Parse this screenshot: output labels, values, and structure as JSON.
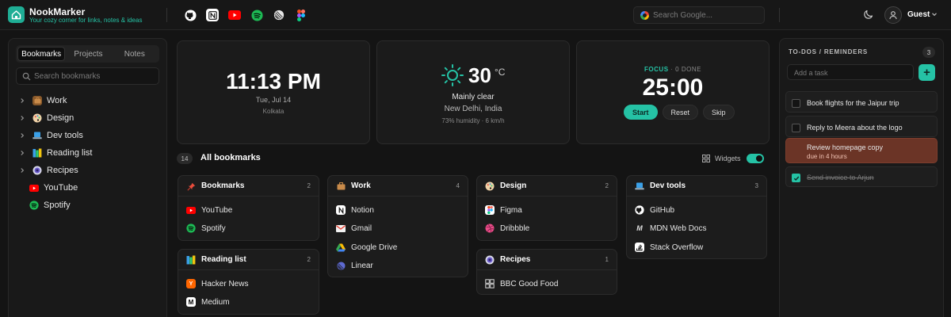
{
  "app": {
    "name": "NookMarker",
    "tagline": "Your cozy corner for links, notes & ideas"
  },
  "header": {
    "quick_links": [
      {
        "icon": "github-icon",
        "color": "#ffffff"
      },
      {
        "icon": "notion-icon",
        "color": "#ffffff"
      },
      {
        "icon": "youtube-icon",
        "color": "#ff0000"
      },
      {
        "icon": "spotify-icon",
        "color": "#1db954"
      },
      {
        "icon": "linear-icon",
        "color": "#e6e6e6"
      },
      {
        "icon": "figma-icon",
        "color": "#f24e1e"
      }
    ],
    "search_placeholder": "Search Google...",
    "user": "Guest"
  },
  "sidebar": {
    "tabs": [
      "Bookmarks",
      "Projects",
      "Notes"
    ],
    "active_tab": "Bookmarks",
    "search_placeholder": "Search bookmarks",
    "items": [
      {
        "label": "Work",
        "icon": "briefcase-icon",
        "expandable": true
      },
      {
        "label": "Design",
        "icon": "palette-icon",
        "expandable": true
      },
      {
        "label": "Dev tools",
        "icon": "laptop-icon",
        "expandable": true
      },
      {
        "label": "Reading list",
        "icon": "books-icon",
        "expandable": true
      },
      {
        "label": "Recipes",
        "icon": "recipes-icon",
        "expandable": true
      },
      {
        "label": "YouTube",
        "icon": "youtube-icon",
        "expandable": false
      },
      {
        "label": "Spotify",
        "icon": "spotify-icon",
        "expandable": false
      }
    ]
  },
  "clock": {
    "time": "11:13 PM",
    "date": "Tue, Jul 14",
    "city": "Kolkata"
  },
  "weather": {
    "temp": "30",
    "unit": "°C",
    "condition": "Mainly clear",
    "location": "New Delhi, India",
    "details": "73% humidity · 6 km/h"
  },
  "focus": {
    "label": "FOCUS",
    "separator": "·",
    "done": "0 DONE",
    "timer": "25:00",
    "start": "Start",
    "reset": "Reset",
    "skip": "Skip"
  },
  "bookmarks": {
    "count": "14",
    "title": "All bookmarks",
    "widgets_label": "Widgets",
    "widgets_on": true,
    "groups": [
      {
        "title": "Bookmarks",
        "count": "2",
        "icon": "pin-icon",
        "items": [
          {
            "label": "YouTube",
            "icon": "youtube-icon"
          },
          {
            "label": "Spotify",
            "icon": "spotify-icon"
          }
        ]
      },
      {
        "title": "Reading list",
        "count": "2",
        "icon": "books-icon",
        "items": [
          {
            "label": "Hacker News",
            "icon": "hackernews-icon"
          },
          {
            "label": "Medium",
            "icon": "medium-icon"
          }
        ]
      },
      {
        "title": "Work",
        "count": "4",
        "icon": "briefcase-icon",
        "items": [
          {
            "label": "Notion",
            "icon": "notion-icon"
          },
          {
            "label": "Gmail",
            "icon": "gmail-icon"
          },
          {
            "label": "Google Drive",
            "icon": "google-drive-icon"
          },
          {
            "label": "Linear",
            "icon": "linear-icon"
          }
        ]
      },
      {
        "title": "Design",
        "count": "2",
        "icon": "palette-icon",
        "items": [
          {
            "label": "Figma",
            "icon": "figma-icon"
          },
          {
            "label": "Dribbble",
            "icon": "dribbble-icon"
          }
        ]
      },
      {
        "title": "Recipes",
        "count": "1",
        "icon": "recipes-icon",
        "items": [
          {
            "label": "BBC Good Food",
            "icon": "bbc-icon"
          }
        ]
      },
      {
        "title": "Dev tools",
        "count": "3",
        "icon": "laptop-icon",
        "items": [
          {
            "label": "GitHub",
            "icon": "github-icon"
          },
          {
            "label": "MDN Web Docs",
            "icon": "mdn-icon"
          },
          {
            "label": "Stack Overflow",
            "icon": "stackoverflow-icon"
          }
        ]
      }
    ]
  },
  "todo": {
    "title": "TO-DOS / REMINDERS",
    "count": "3",
    "placeholder": "Add a task",
    "add_label": "+",
    "tasks": [
      {
        "text": "Book flights for the Jaipur trip",
        "done": false,
        "due": ""
      },
      {
        "text": "Reply to Meera about the logo",
        "done": false,
        "due": ""
      },
      {
        "text": "Review homepage copy",
        "done": false,
        "due": "due in 4 hours"
      },
      {
        "text": "Send invoice to Arjun",
        "done": true,
        "due": ""
      }
    ]
  },
  "colors": {
    "accent": "#25c2a5",
    "reminder": "#6b3426"
  }
}
